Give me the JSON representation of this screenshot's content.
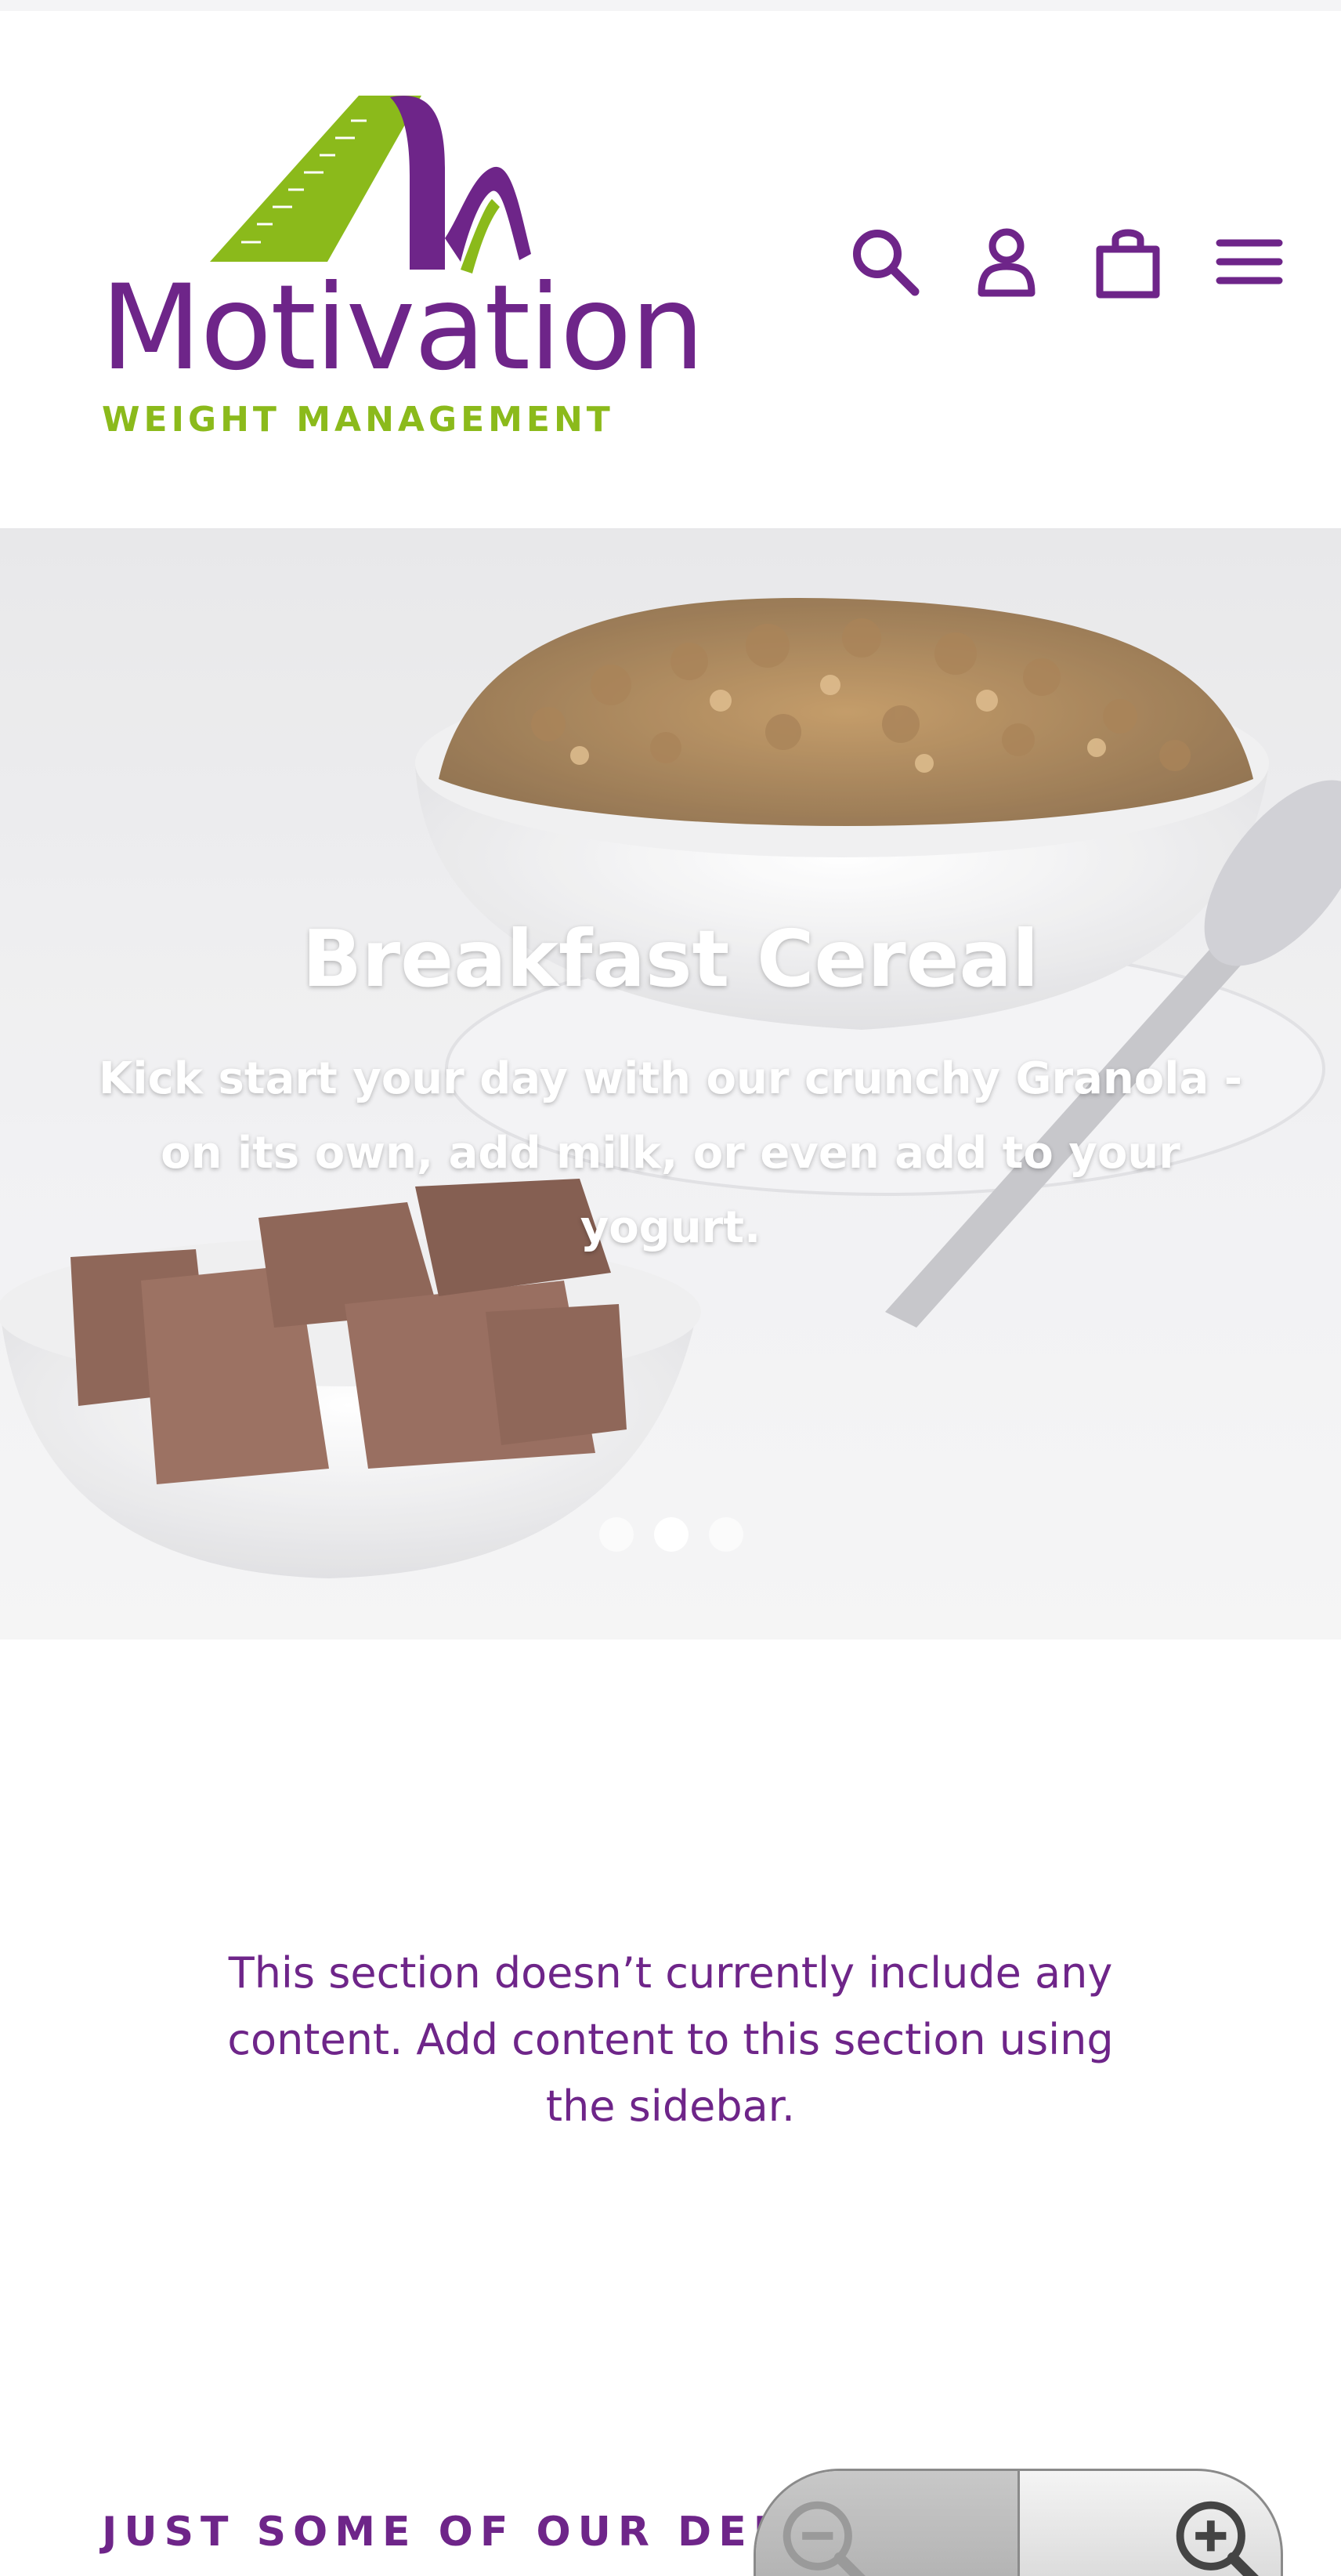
{
  "header": {
    "logo": {
      "name": "Motivation",
      "tagline": "WEIGHT MANAGEMENT"
    },
    "icons": [
      "search-icon",
      "account-icon",
      "cart-icon",
      "menu-icon"
    ]
  },
  "hero": {
    "title": "Breakfast Cereal",
    "text": "Kick start your day with our crunchy Granola - on its own, add milk, or even add to your yogurt.",
    "slides": {
      "count": 3,
      "active_index": 1
    }
  },
  "empty_section": {
    "message": "This section doesn’t currently include any content. Add content to this section using the sidebar."
  },
  "featured": {
    "heading": "JUST SOME OF OUR DELICI"
  },
  "zoom": {
    "icons": [
      "zoom-out-icon",
      "zoom-in-icon"
    ]
  },
  "colors": {
    "brand_purple": "#6e2589",
    "brand_green": "#8bba1b"
  }
}
